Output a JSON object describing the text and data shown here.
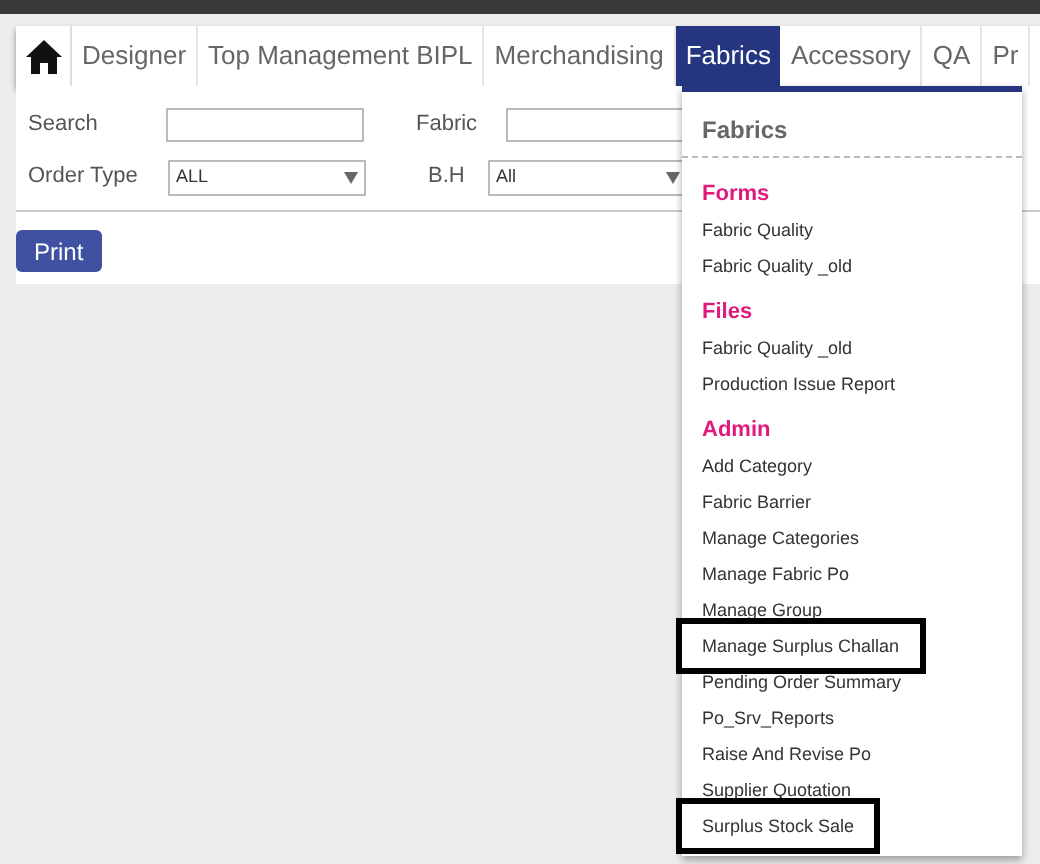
{
  "nav": {
    "tabs": [
      {
        "label": "Designer",
        "selected": false
      },
      {
        "label": "Top Management BIPL",
        "selected": false
      },
      {
        "label": "Merchandising",
        "selected": false
      },
      {
        "label": "Fabrics",
        "selected": true
      },
      {
        "label": "Accessory",
        "selected": false
      },
      {
        "label": "QA",
        "selected": false
      },
      {
        "label": "Pr",
        "selected": false
      }
    ]
  },
  "filters": {
    "search": {
      "label": "Search"
    },
    "fabric": {
      "label": "Fabric"
    },
    "order_type": {
      "label": "Order Type",
      "value": "ALL"
    },
    "bh": {
      "label": "B.H",
      "value": "All"
    }
  },
  "print_button": "Print",
  "dropdown": {
    "title": "Fabrics",
    "sections": [
      {
        "heading": "Forms",
        "items": [
          {
            "label": "Fabric Quality",
            "highlighted": false
          },
          {
            "label": "Fabric Quality _old",
            "highlighted": false
          }
        ]
      },
      {
        "heading": "Files",
        "items": [
          {
            "label": "Fabric Quality _old",
            "highlighted": false
          },
          {
            "label": "Production Issue Report",
            "highlighted": false
          }
        ]
      },
      {
        "heading": "Admin",
        "items": [
          {
            "label": "Add Category",
            "highlighted": false
          },
          {
            "label": "Fabric Barrier",
            "highlighted": false
          },
          {
            "label": "Manage Categories",
            "highlighted": false
          },
          {
            "label": "Manage Fabric Po",
            "highlighted": false
          },
          {
            "label": "Manage Group",
            "highlighted": false
          },
          {
            "label": "Manage Surplus Challan",
            "highlighted": true
          },
          {
            "label": "Pending Order Summary",
            "highlighted": false
          },
          {
            "label": "Po_Srv_Reports",
            "highlighted": false
          },
          {
            "label": "Raise And Revise Po",
            "highlighted": false
          },
          {
            "label": "Supplier Quotation",
            "highlighted": false
          },
          {
            "label": "Surplus Stock Sale",
            "highlighted": true
          }
        ]
      }
    ]
  }
}
